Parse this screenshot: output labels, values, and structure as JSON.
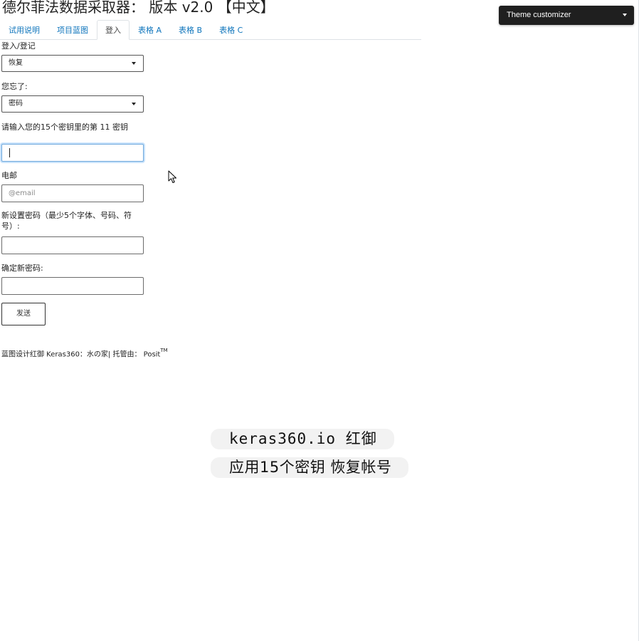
{
  "app": {
    "title": "德尔菲法数据采取器： 版本 v2.0 【中文】"
  },
  "tabs": [
    {
      "label": "试用说明",
      "active": false
    },
    {
      "label": "项目蓝图",
      "active": false
    },
    {
      "label": "登入",
      "active": true
    },
    {
      "label": "表格 A",
      "active": false
    },
    {
      "label": "表格 B",
      "active": false
    },
    {
      "label": "表格 C",
      "active": false
    }
  ],
  "form": {
    "login_label": "登入/登记",
    "login_select_value": "恢复",
    "forgot_label": "您忘了:",
    "forgot_select_value": "密码",
    "key_label": "请输入您的15个密钥里的第 11 密钥",
    "key_value": "",
    "email_label": "电邮",
    "email_placeholder": "@email",
    "new_password_label": "新设置密码（最少5个字体、号码、符号）:",
    "new_password_value": "",
    "confirm_password_label": "确定新密码:",
    "confirm_password_value": "",
    "submit_label": "发送"
  },
  "footer": {
    "text": "蓝图设计红御 Keras360：水の家| 托管由： Posit",
    "trademark": "TM"
  },
  "theme_customizer": {
    "label": "Theme customizer"
  },
  "caption": {
    "line1": "keras360.io 红御",
    "line2": "应用15个密钥 恢复帐号"
  },
  "colors": {
    "tab_link": "#0f75bc",
    "theme_button_bg": "#1f1f1f",
    "focus_ring": "#6fa8dc"
  }
}
